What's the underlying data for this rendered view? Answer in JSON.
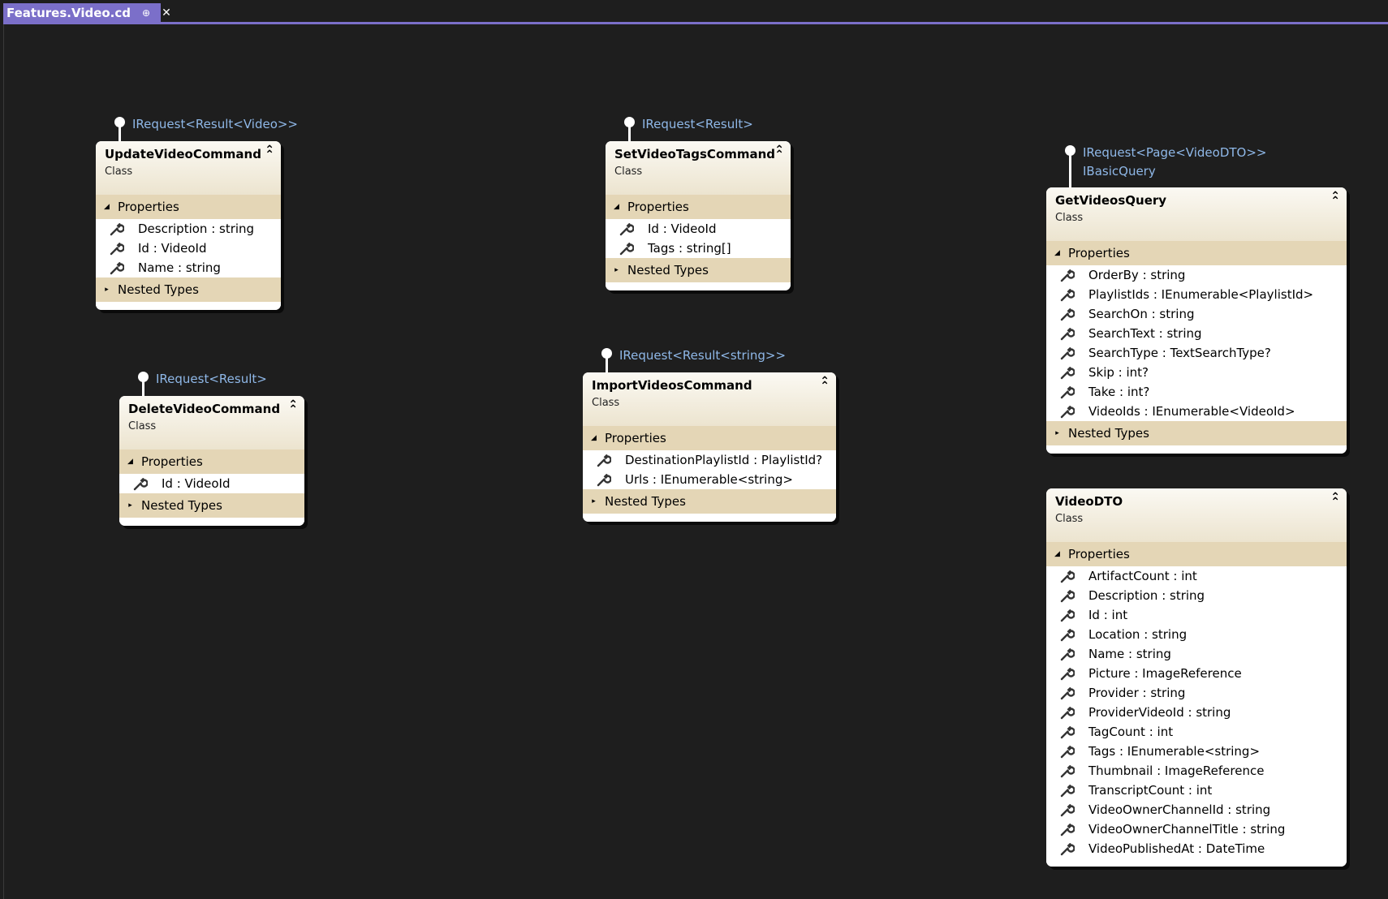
{
  "tab": {
    "title": "Features.Video.cd",
    "pin_icon": "⊕",
    "close_icon": "✕"
  },
  "classes": {
    "update": {
      "interfaces": [
        "IRequest<Result<Video>>"
      ],
      "name": "UpdateVideoCommand",
      "kind": "Class",
      "properties_label": "Properties",
      "properties": [
        "Description : string",
        "Id : VideoId",
        "Name : string"
      ],
      "nested_label": "Nested Types"
    },
    "settags": {
      "interfaces": [
        "IRequest<Result>"
      ],
      "name": "SetVideoTagsCommand",
      "kind": "Class",
      "properties_label": "Properties",
      "properties": [
        "Id : VideoId",
        "Tags : string[]"
      ],
      "nested_label": "Nested Types"
    },
    "getvideos": {
      "interfaces": [
        "IRequest<Page<VideoDTO>>",
        "IBasicQuery"
      ],
      "name": "GetVideosQuery",
      "kind": "Class",
      "properties_label": "Properties",
      "properties": [
        "OrderBy : string",
        "PlaylistIds : IEnumerable<PlaylistId>",
        "SearchOn : string",
        "SearchText : string",
        "SearchType : TextSearchType?",
        "Skip : int?",
        "Take : int?",
        "VideoIds : IEnumerable<VideoId>"
      ],
      "nested_label": "Nested Types"
    },
    "delete": {
      "interfaces": [
        "IRequest<Result>"
      ],
      "name": "DeleteVideoCommand",
      "kind": "Class",
      "properties_label": "Properties",
      "properties": [
        "Id : VideoId"
      ],
      "nested_label": "Nested Types"
    },
    "import": {
      "interfaces": [
        "IRequest<Result<string>>"
      ],
      "name": "ImportVideosCommand",
      "kind": "Class",
      "properties_label": "Properties",
      "properties": [
        "DestinationPlaylistId : PlaylistId?",
        "Urls : IEnumerable<string>"
      ],
      "nested_label": "Nested Types"
    },
    "dto": {
      "name": "VideoDTO",
      "kind": "Class",
      "properties_label": "Properties",
      "properties": [
        "ArtifactCount : int",
        "Description : string",
        "Id : int",
        "Location : string",
        "Name : string",
        "Picture : ImageReference",
        "Provider : string",
        "ProviderVideoId : string",
        "TagCount : int",
        "Tags : IEnumerable<string>",
        "Thumbnail : ImageReference",
        "TranscriptCount : int",
        "VideoOwnerChannelId : string",
        "VideoOwnerChannelTitle : string",
        "VideoPublishedAt : DateTime"
      ]
    }
  },
  "colors": {
    "background": "#1e1e1e",
    "tab_accent": "#7b6fc9",
    "interface_label": "#8fb8e8",
    "compartment": "#e4d6b6",
    "header_gradient_top": "#fbf9f3",
    "header_gradient_bottom": "#ece4cf"
  },
  "icons": {
    "property": "wrench-icon",
    "collapse": "double-chevron-up-icon",
    "expanded": "triangle-down-icon",
    "collapsed": "triangle-right-icon"
  }
}
